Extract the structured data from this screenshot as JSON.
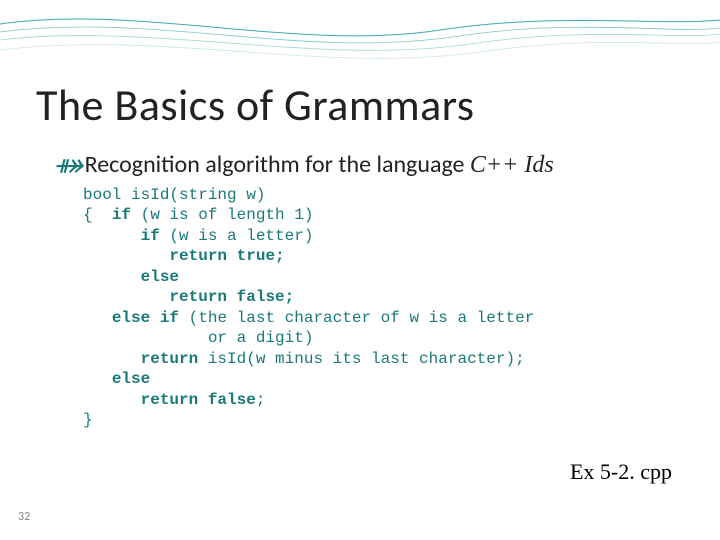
{
  "slide": {
    "title": "The Basics of Grammars",
    "bullet_prefix": "Recognition algorithm for the language ",
    "bullet_italic": "C++ Ids",
    "footer_ref": "Ex 5-2. cpp",
    "number": "32"
  },
  "code": {
    "l1a": "bool isId(string w)",
    "l2a": "{  ",
    "l2b": "if",
    "l2c": " (w is of length 1)",
    "l3a": "      ",
    "l3b": "if",
    "l3c": " (w is a letter)",
    "l4a": "         ",
    "l4b": "return true;",
    "l5a": "      ",
    "l5b": "else",
    "l6a": "         ",
    "l6b": "return false;",
    "l7a": "   ",
    "l7b": "else if",
    "l7c": " (the last character of w is a letter",
    "l8a": "             or a digit)",
    "l9a": "      ",
    "l9b": "return",
    "l9c": " isId(w minus its last character);",
    "l10a": "   ",
    "l10b": "else",
    "l11a": "      ",
    "l11b": "return false",
    "l11c": ";",
    "l12a": "}"
  }
}
